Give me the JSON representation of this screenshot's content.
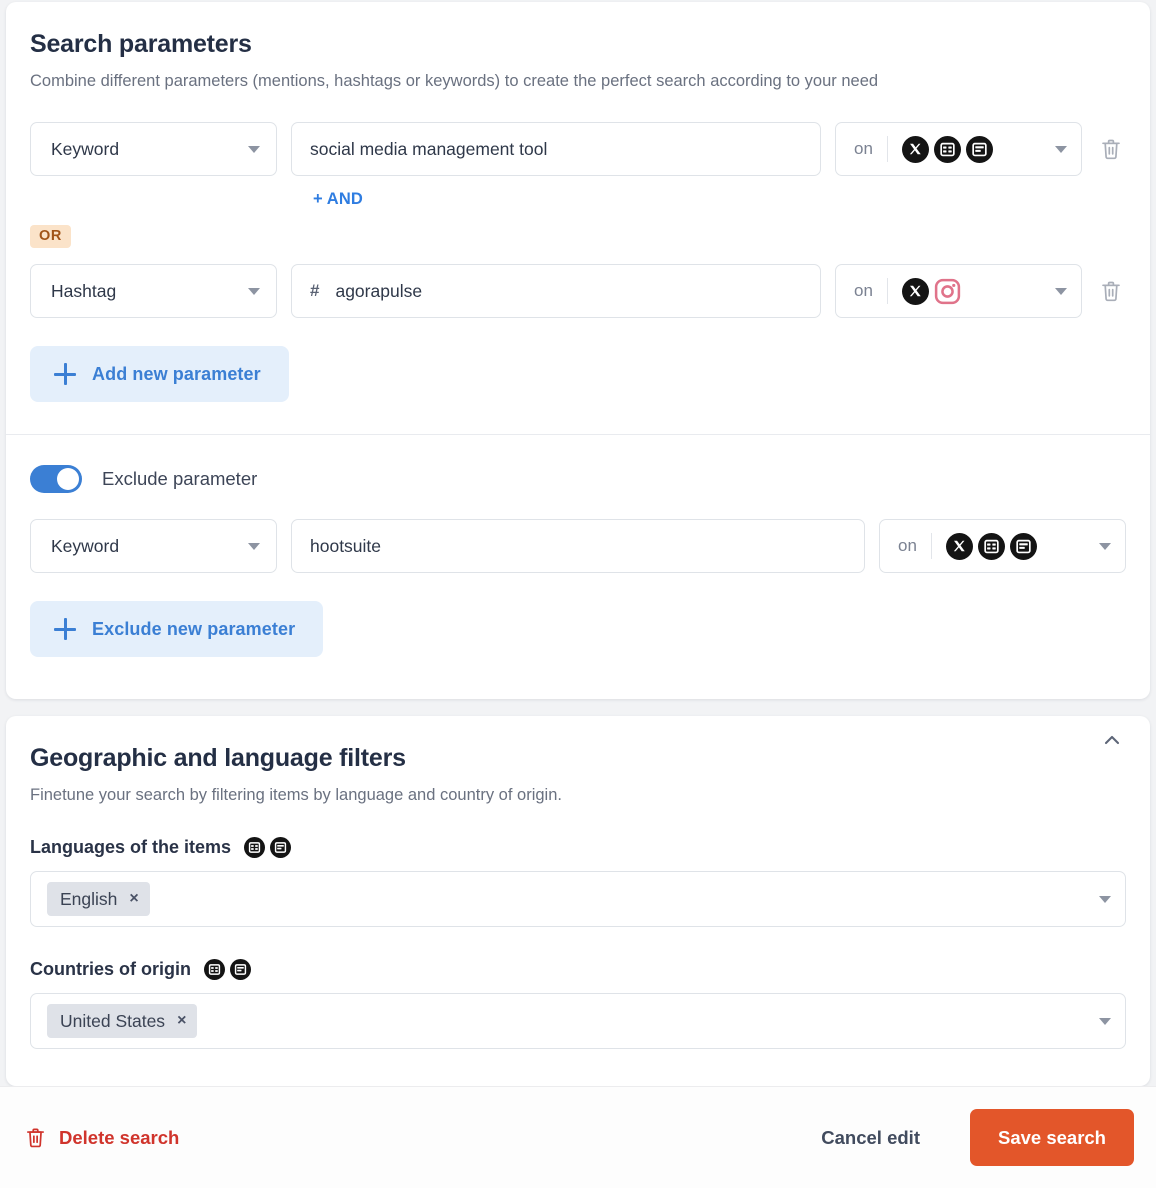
{
  "search_parameters": {
    "title": "Search parameters",
    "description": "Combine different parameters (mentions, hashtags or keywords) to create the perfect search according to your need",
    "and_link_label": "+ AND",
    "or_badge_label": "OR",
    "add_parameter_label": "Add new parameter",
    "rows": [
      {
        "type_label": "Keyword",
        "value": "social media management tool",
        "value_prefix": "",
        "platform_prefix": "on",
        "platforms": [
          "x-icon",
          "web-icon",
          "news-icon"
        ],
        "has_delete": true,
        "delete_icon": "trash-icon"
      },
      {
        "type_label": "Hashtag",
        "value": "agorapulse",
        "value_prefix": "#",
        "platform_prefix": "on",
        "platforms": [
          "x-icon",
          "instagram-icon"
        ],
        "has_delete": true,
        "delete_icon": "trash-icon"
      }
    ]
  },
  "exclude_section": {
    "toggle_label": "Exclude parameter",
    "toggle_on": true,
    "add_label": "Exclude new parameter",
    "row": {
      "type_label": "Keyword",
      "value": "hootsuite",
      "platform_prefix": "on",
      "platforms": [
        "x-icon",
        "web-icon",
        "news-icon"
      ]
    }
  },
  "geographic_section": {
    "title": "Geographic and language filters",
    "description": "Finetune your search by filtering items by language and country of origin.",
    "collapse_icon": "chevron-up-icon",
    "languages": {
      "label": "Languages of the items",
      "icons": [
        "web-icon",
        "news-icon"
      ],
      "chips": [
        {
          "label": "English",
          "remove": "×"
        }
      ]
    },
    "countries": {
      "label": "Countries of origin",
      "icons": [
        "web-icon",
        "news-icon"
      ],
      "chips": [
        {
          "label": "United States",
          "remove": "×"
        }
      ]
    }
  },
  "footer": {
    "delete_label": "Delete search",
    "delete_icon": "trash-icon",
    "cancel_label": "Cancel edit",
    "save_label": "Save search"
  },
  "colors": {
    "accent_orange": "#e3562a",
    "link_blue": "#3b7fd4",
    "delete_red": "#d0342c",
    "or_badge_bg": "#fbe3c9",
    "or_badge_fg": "#a15418",
    "toggle_on": "#3b7fd4"
  }
}
